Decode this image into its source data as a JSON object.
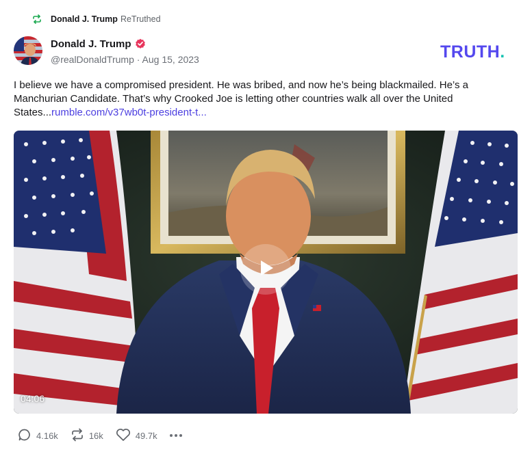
{
  "retruth": {
    "icon": "retruth-icon",
    "name": "Donald J. Trump",
    "suffix": "ReTruthed"
  },
  "author": {
    "avatar_icon": "avatar",
    "name": "Donald J. Trump",
    "verified_icon": "verified-badge-icon",
    "handle": "@realDonaldTrump",
    "separator": "·",
    "date": "Aug 15, 2023"
  },
  "logo": {
    "text": "TRUTH",
    "dot": ".",
    "colors": {
      "main": "#5448ee",
      "dot": "#17c3b2"
    }
  },
  "post": {
    "text": "I believe we have a compromised president. He was bribed, and now he’s being blackmailed. He’s a Manchurian Candidate. That’s why Crooked Joe is letting other countries walk all over the United States...",
    "link": "rumble.com/v37wb0t-president-t..."
  },
  "video": {
    "duration": "04:06",
    "play_icon": "play-icon"
  },
  "actions": {
    "replies": "4.16k",
    "retruths": "16k",
    "likes": "49.7k",
    "more_icon": "more-dots-icon"
  }
}
